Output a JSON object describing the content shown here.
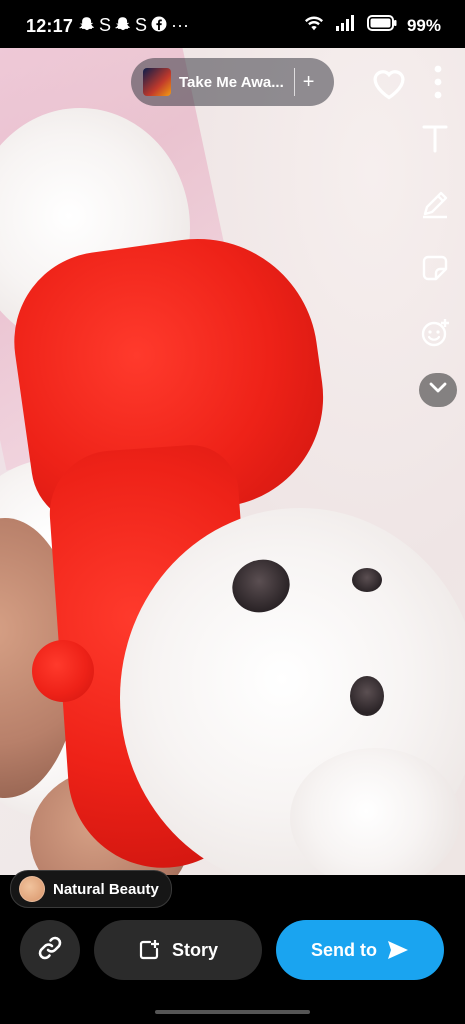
{
  "status_bar": {
    "time": "12:17",
    "notifications": [
      "ghost-icon",
      "S",
      "ghost-icon",
      "S",
      "facebook-icon",
      "···"
    ],
    "battery": "99%"
  },
  "music": {
    "song_title": "Take Me Awa...",
    "add_label": "+"
  },
  "tools": [
    "text-icon",
    "pencil-icon",
    "sticker-icon",
    "emoji-add-icon",
    "chevron-down-icon"
  ],
  "tag": {
    "label": "Natural Beauty"
  },
  "actions": {
    "story_label": "Story",
    "send_label": "Send to"
  },
  "colors": {
    "send_button": "#1aa4f0",
    "secondary_button": "#2b2b2b",
    "hoodie": "#ee2218"
  }
}
